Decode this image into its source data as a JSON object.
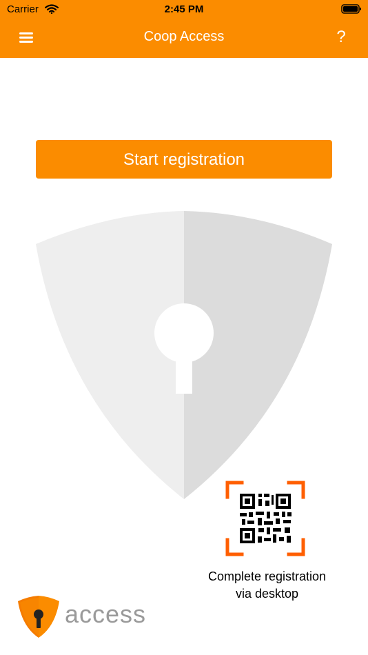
{
  "status_bar": {
    "carrier": "Carrier",
    "time": "2:45 PM",
    "wifi_icon": "wifi-icon",
    "battery_icon": "battery-icon"
  },
  "navbar": {
    "title": "Coop Access",
    "menu_icon": "hamburger-menu-icon",
    "help_label": "?"
  },
  "main": {
    "start_button_label": "Start registration",
    "illustration": "shield-keyhole-icon"
  },
  "desktop_registration": {
    "icon": "qr-code-icon",
    "label_line1": "Complete registration",
    "label_line2": "via desktop"
  },
  "footer": {
    "logo_icon": "access-shield-logo",
    "brand_text": "access"
  },
  "colors": {
    "primary": "#fb8c00",
    "shield_light": "#eeeeee",
    "shield_dark": "#dcdcdc",
    "logo_text": "#9a9a9a",
    "background": "#ffffff"
  }
}
